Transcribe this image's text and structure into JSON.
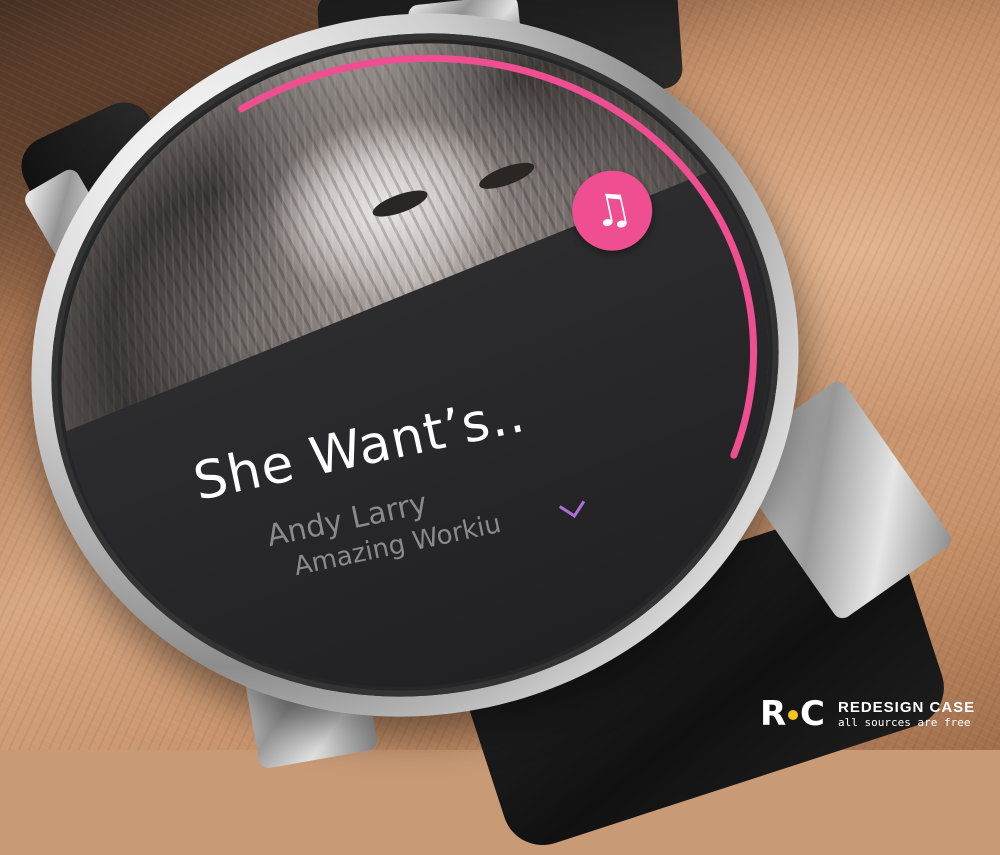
{
  "track": {
    "title": "She Want’s..",
    "artist": "Andy Larry",
    "album": "Amazing Workiu",
    "progress": 0.62
  },
  "icons": {
    "music": "music-note-icon",
    "expand": "chevron-down-icon"
  },
  "colors": {
    "accent": "#ef4f91",
    "chevron": "#b06fd6",
    "panel": "#252628"
  },
  "brand": {
    "name": "REDESIGN CASE",
    "tagline": "all sources are free",
    "logo_text": "RC"
  }
}
